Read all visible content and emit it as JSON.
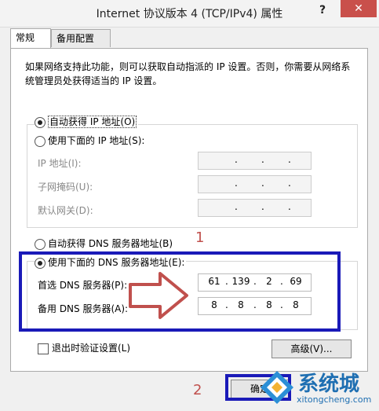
{
  "window": {
    "title": "Internet 协议版本 4 (TCP/IPv4) 属性",
    "help_glyph": "?",
    "close_glyph": "✕"
  },
  "tabs": [
    {
      "label": "常规"
    },
    {
      "label": "备用配置"
    }
  ],
  "description": "如果网络支持此功能，则可以获取自动指派的 IP 设置。否则，你需要从网络系统管理员处获得适当的 IP 设置。",
  "ip_section": {
    "auto_label": "自动获得 IP 地址(O)",
    "manual_label": "使用下面的 IP 地址(S):",
    "ip_label": "IP 地址(I):",
    "subnet_label": "子网掩码(U):",
    "gateway_label": "默认网关(D):"
  },
  "dns_section": {
    "auto_label": "自动获得 DNS 服务器地址(B)",
    "manual_label": "使用下面的 DNS 服务器地址(E):",
    "preferred_label": "首选 DNS 服务器(P):",
    "alternate_label": "备用 DNS 服务器(A):",
    "preferred": [
      "61",
      "139",
      "2",
      "69"
    ],
    "alternate": [
      "8",
      "8",
      "8",
      "8"
    ]
  },
  "validate_label": "退出时验证设置(L)",
  "advanced_label": "高级(V)...",
  "ok_label": "确定",
  "annotations": {
    "one": "1",
    "two": "2"
  },
  "watermark": {
    "brand": "系统城",
    "url": "xitongcheng.com"
  },
  "colors": {
    "highlight": "#1a1ab8",
    "annotation": "#c0504d",
    "close": "#c9504b"
  }
}
